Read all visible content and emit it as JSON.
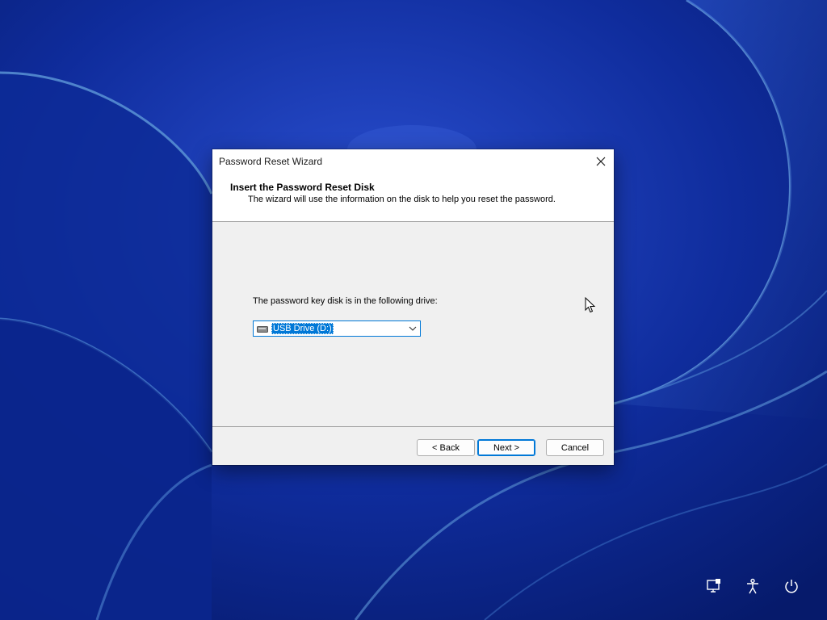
{
  "dialog": {
    "title": "Password Reset Wizard",
    "header_title": "Insert the Password Reset Disk",
    "header_subtitle": "The wizard will use the information on the disk to help you reset the password.",
    "drive_label": "The password key disk is in the following drive:",
    "drive_selected": "USB Drive (D:)",
    "buttons": {
      "back": "< Back",
      "next": "Next >",
      "cancel": "Cancel"
    }
  },
  "colors": {
    "accent": "#0078d7",
    "wallpaper_base": "#0b2a9a"
  },
  "system_icons": [
    "network-icon",
    "accessibility-icon",
    "power-icon"
  ]
}
